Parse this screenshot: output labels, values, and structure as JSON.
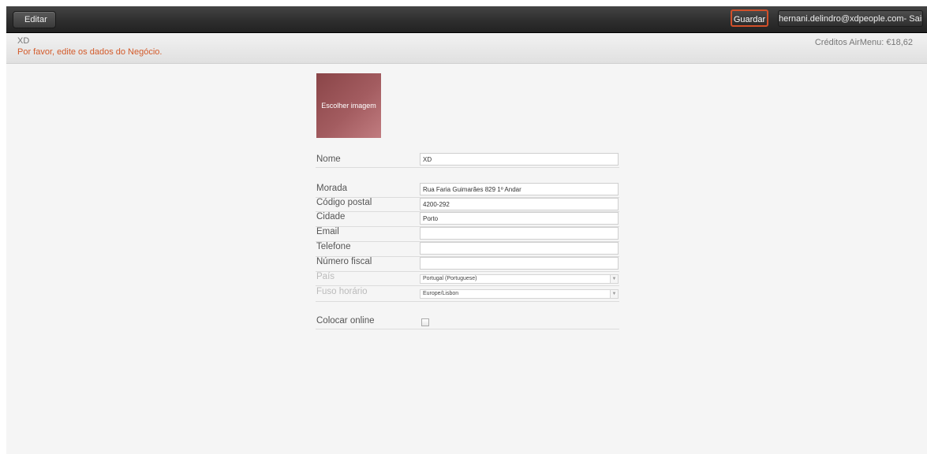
{
  "topbar": {
    "back_label": "Editar",
    "save_label": "Guardar",
    "user_label": "hernani.delindro@xdpeople.com- Sair",
    "accent": "#d2502a"
  },
  "infobar": {
    "business_name": "XD",
    "hint": "Por favor, edite os dados do Negócio.",
    "credits": "Créditos AirMenu: €18,62"
  },
  "form": {
    "image_button": "Escolher imagem",
    "name": {
      "label": "Nome",
      "value": "XD"
    },
    "address": {
      "label": "Morada",
      "value": "Rua Faria Guimarães 829 1º Andar"
    },
    "postal_code": {
      "label": "Código postal",
      "value": "4200-292"
    },
    "city": {
      "label": "Cidade",
      "value": "Porto"
    },
    "email": {
      "label": "Email",
      "value": ""
    },
    "phone": {
      "label": "Telefone",
      "value": ""
    },
    "tax_number": {
      "label": "Número fiscal",
      "value": ""
    },
    "country": {
      "label": "País",
      "value": "Portugal (Portuguese)"
    },
    "timezone": {
      "label": "Fuso horário",
      "value": "Europe/Lisbon"
    },
    "online": {
      "label": "Colocar online",
      "checked": false
    }
  }
}
